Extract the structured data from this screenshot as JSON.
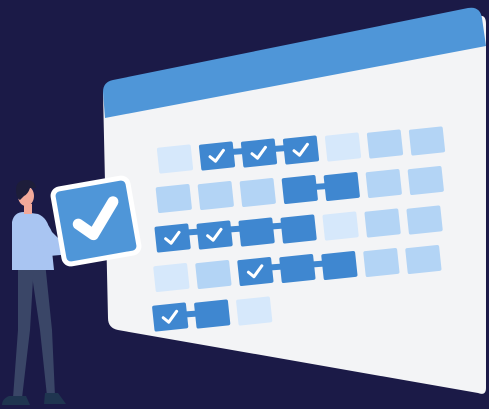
{
  "colors": {
    "background": "#1b1a47",
    "calendar_header": "#4f96d8",
    "calendar_body": "#f3f4f6",
    "cell_light": "#d6e8fb",
    "cell_mid": "#b3d4f5",
    "cell_dark": "#3f87d0",
    "check_mark": "#ffffff",
    "card_fill": "#4f96d8",
    "card_border": "#ffffff",
    "person_shirt": "#a9c5f2",
    "person_pants": "#3a4667",
    "person_skin": "#f2a99a",
    "person_hair": "#1d1d3a",
    "person_shoes": "#1f3550"
  },
  "calendar": {
    "rows": [
      [
        "light",
        "dark-check",
        "dark-check",
        "dark-check",
        "light",
        "mid",
        "mid"
      ],
      [
        "mid",
        "mid",
        "mid",
        "dark",
        "dark",
        "mid",
        "mid"
      ],
      [
        "dark-check",
        "dark-check",
        "dark",
        "dark",
        "light",
        "mid",
        "mid"
      ],
      [
        "light",
        "mid",
        "dark-check",
        "dark",
        "dark",
        "mid",
        "mid"
      ],
      [
        "dark-check",
        "dark",
        "light",
        "none",
        "none",
        "none",
        "none"
      ]
    ],
    "links": [
      {
        "row": 0,
        "from": 1,
        "to": 3
      },
      {
        "row": 1,
        "from": 3,
        "to": 4
      },
      {
        "row": 2,
        "from": 0,
        "to": 3
      },
      {
        "row": 3,
        "from": 2,
        "to": 4
      },
      {
        "row": 4,
        "from": 0,
        "to": 1
      }
    ]
  },
  "icons": {
    "card": "check-icon",
    "cell": "check-icon"
  }
}
